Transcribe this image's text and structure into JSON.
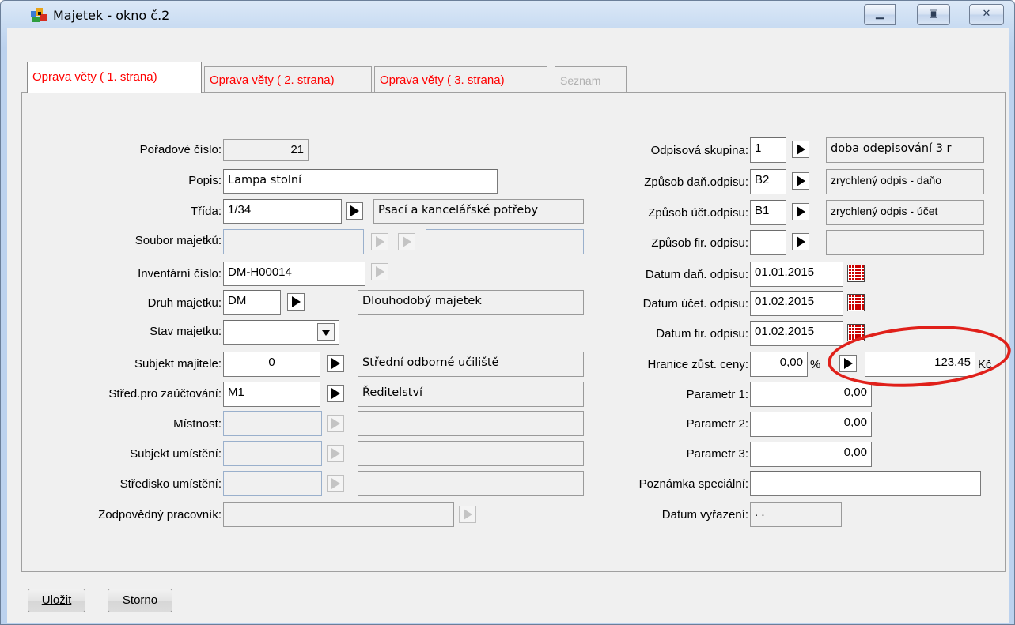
{
  "window": {
    "title": "Majetek - okno č.2"
  },
  "tabs": [
    {
      "label": "Oprava věty ( 1. strana)",
      "state": "active"
    },
    {
      "label": "Oprava věty ( 2. strana)",
      "state": "normal"
    },
    {
      "label": "Oprava věty ( 3. strana)",
      "state": "normal"
    },
    {
      "label": "Seznam",
      "state": "disabled"
    }
  ],
  "left": {
    "poradove_cislo": {
      "label": "Pořadové číslo:",
      "value": "21"
    },
    "popis": {
      "label": "Popis:",
      "value": "Lampa stolní"
    },
    "trida": {
      "label": "Třída:",
      "value": "1/34",
      "desc": "Psací a kancelářské potřeby"
    },
    "soubor_majetku": {
      "label": "Soubor majetků:",
      "value": "",
      "desc": ""
    },
    "inventarni_cislo": {
      "label": "Inventární číslo:",
      "value": "DM-H00014"
    },
    "druh_majetku": {
      "label": "Druh majetku:",
      "value": "DM",
      "desc": "Dlouhodobý majetek"
    },
    "stav_majetku": {
      "label": "Stav majetku:",
      "value": ""
    },
    "subjekt_majitele": {
      "label": "Subjekt majitele:",
      "value": "0",
      "desc": "Střední odborné učiliště"
    },
    "stred_zauctovani": {
      "label": "Střed.pro zaúčtování:",
      "value": "M1",
      "desc": "Ředitelství"
    },
    "mistnost": {
      "label": "Místnost:",
      "value": "",
      "desc": ""
    },
    "subjekt_umisteni": {
      "label": "Subjekt umístění:",
      "value": "",
      "desc": ""
    },
    "stredisko_umisteni": {
      "label": "Středisko umístění:",
      "value": "",
      "desc": ""
    },
    "zodpovedny_pracovnik": {
      "label": "Zodpovědný pracovník:",
      "value": ""
    }
  },
  "right": {
    "odpisova_skupina": {
      "label": "Odpisová skupina:",
      "value": "1",
      "desc": "doba odepisování 3 r"
    },
    "zpusob_dan_odpisu": {
      "label": "Způsob daň.odpisu:",
      "value": "B2",
      "desc": "zrychlený odpis - daňo"
    },
    "zpusob_uct_odpisu": {
      "label": "Způsob účt.odpisu:",
      "value": "B1",
      "desc": "zrychlený odpis - účet"
    },
    "zpusob_fir_odpisu": {
      "label": "Způsob fir. odpisu:",
      "value": "",
      "desc": ""
    },
    "datum_dan_odpisu": {
      "label": "Datum daň. odpisu:",
      "value": "01.01.2015"
    },
    "datum_uct_odpisu": {
      "label": "Datum účet. odpisu:",
      "value": "01.02.2015"
    },
    "datum_fir_odpisu": {
      "label": "Datum fir. odpisu:",
      "value": "01.02.2015"
    },
    "hranice": {
      "label": "Hranice zůst. ceny:",
      "percent": "0,00",
      "percent_unit": "%",
      "amount": "123,45",
      "amount_unit": "Kč"
    },
    "parametr1": {
      "label": "Parametr 1:",
      "value": "0,00"
    },
    "parametr2": {
      "label": "Parametr 2:",
      "value": "0,00"
    },
    "parametr3": {
      "label": "Parametr 3:",
      "value": "0,00"
    },
    "poznamka": {
      "label": "Poznámka speciální:",
      "value": ""
    },
    "datum_vyrazeni": {
      "label": "Datum vyřazení:",
      "value": " .  ."
    }
  },
  "buttons": {
    "save": "Uložit",
    "cancel": "Storno"
  },
  "colors": {
    "tab_text": "#ff0000",
    "highlight": "#e0201a"
  }
}
